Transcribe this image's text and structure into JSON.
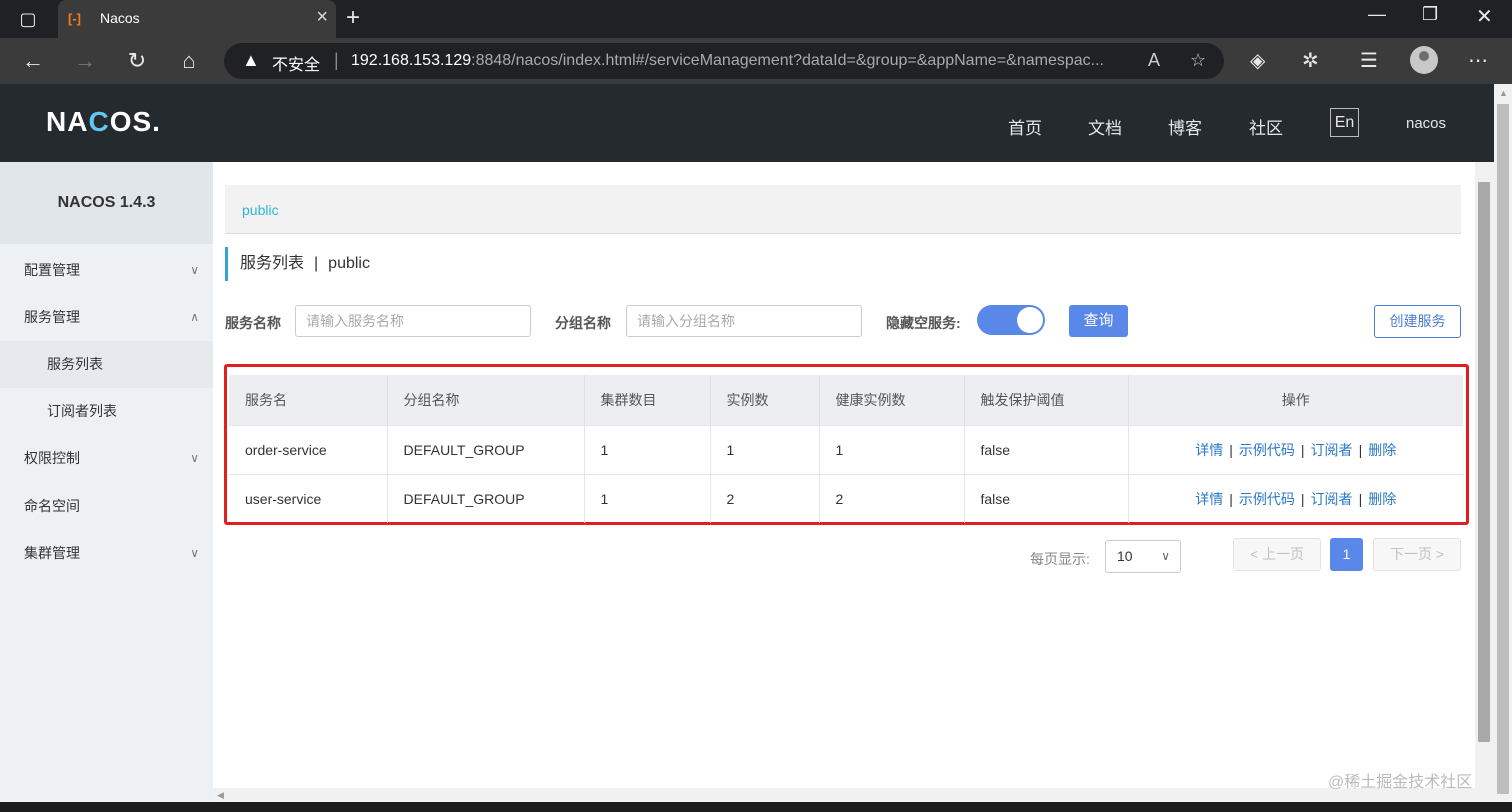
{
  "browser": {
    "tab_title": "Nacos",
    "tab_favicon": "[-]",
    "insecure_label": "不安全",
    "url_host": "192.168.153.129",
    "url_rest": ":8848/nacos/index.html#/serviceManagement?dataId=&group=&appName=&namespac..."
  },
  "header": {
    "logo_prefix": "NA",
    "logo_accent": "C",
    "logo_suffix": "OS.",
    "nav": [
      "首页",
      "文档",
      "博客",
      "社区"
    ],
    "lang": "En",
    "user": "nacos"
  },
  "sidebar": {
    "version": "NACOS 1.4.3",
    "items": [
      "配置管理",
      "服务管理",
      "服务列表",
      "订阅者列表",
      "权限控制",
      "命名空间",
      "集群管理"
    ]
  },
  "main": {
    "namespace": "public",
    "title": "服务列表",
    "title_sep": "|",
    "title_ns": "public",
    "filters": {
      "service_label": "服务名称",
      "service_placeholder": "请输入服务名称",
      "group_label": "分组名称",
      "group_placeholder": "请输入分组名称",
      "hide_empty_label": "隐藏空服务:",
      "query_button": "查询",
      "create_button": "创建服务"
    },
    "table": {
      "headers": [
        "服务名",
        "分组名称",
        "集群数目",
        "实例数",
        "健康实例数",
        "触发保护阈值",
        "操作"
      ],
      "rows": [
        [
          "order-service",
          "DEFAULT_GROUP",
          "1",
          "1",
          "1",
          "false"
        ],
        [
          "user-service",
          "DEFAULT_GROUP",
          "1",
          "2",
          "2",
          "false"
        ]
      ],
      "actions": [
        "详情",
        "示例代码",
        "订阅者",
        "删除"
      ],
      "action_sep": "|"
    },
    "pagination": {
      "per_page_label": "每页显示:",
      "per_page": "10",
      "prev": "上一页",
      "next": "下一页",
      "current": "1"
    }
  },
  "watermark": "@稀土掘金技术社区",
  "colors": {
    "primary": "#5a88e8",
    "header_bg": "#252a2f",
    "link": "#2a78c8",
    "highlight": "#e02020"
  }
}
